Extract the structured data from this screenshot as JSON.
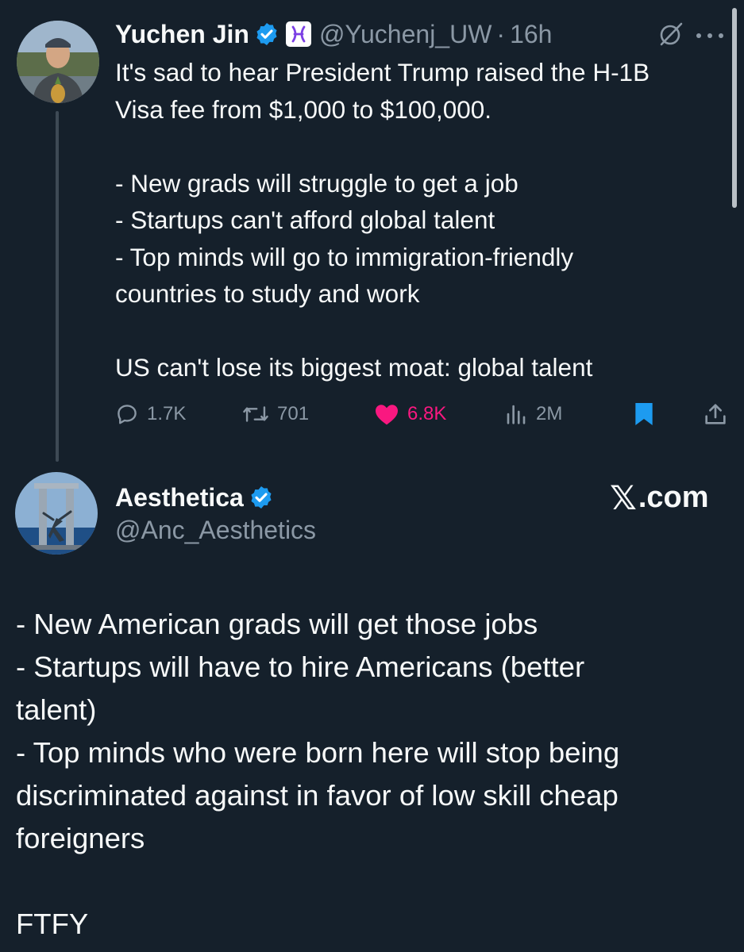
{
  "colors": {
    "background": "#15202b",
    "text": "#f7f9f9",
    "secondary_text": "#8b98a5",
    "like_pink": "#f91880",
    "bookmark_blue": "#1d9bf0",
    "verified_blue": "#1d9bf0"
  },
  "tweet1": {
    "author_name": "Yuchen Jin",
    "handle": "@Yuchenj_UW",
    "separator": "·",
    "time": "16h",
    "verified": true,
    "affiliation_icon": "hyperbolic-logo-icon",
    "body_lines": [
      "It's sad to hear President Trump raised the H-1B",
      "Visa fee from $1,000 to $100,000.",
      "",
      "- New grads will struggle to get a job",
      "- Startups can't afford global talent",
      "- Top minds will go to immigration-friendly",
      "countries to study and work",
      "",
      "US can't lose its biggest moat: global talent"
    ],
    "stats": {
      "replies": "1.7K",
      "retweets": "701",
      "likes": "6.8K",
      "views": "2M"
    },
    "liked": true,
    "bookmarked": true
  },
  "tweet2": {
    "author_name": "Aesthetica",
    "handle": "@Anc_Aesthetics",
    "verified": true,
    "watermark_logo": "𝕏",
    "watermark_text": ".com",
    "body_lines": [
      "- New American grads will get those jobs",
      "- Startups will have to hire Americans (better",
      "talent)",
      "- Top minds who were born here will stop being",
      "discriminated against in favor of low skill cheap",
      "foreigners",
      "",
      "FTFY"
    ]
  }
}
